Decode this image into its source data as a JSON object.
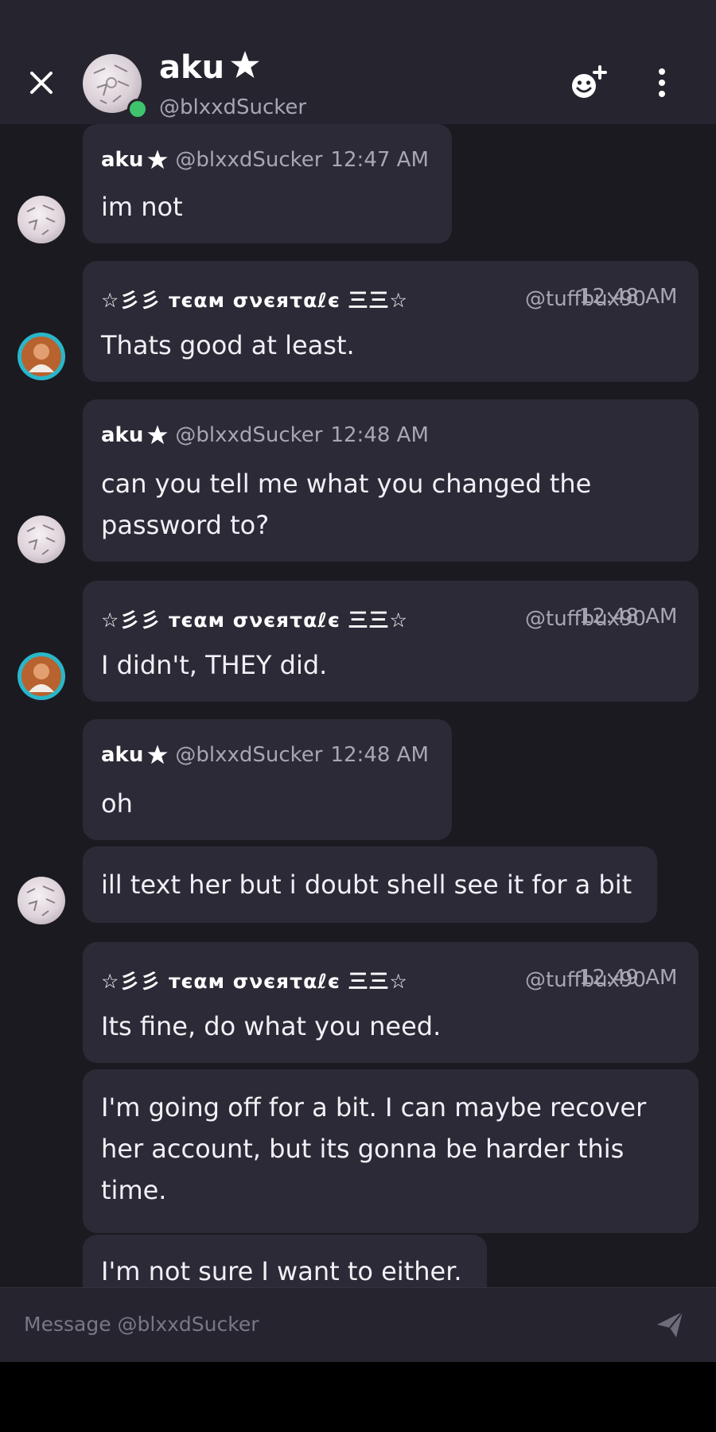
{
  "header": {
    "name": "aku",
    "handle": "@blxxdSucker",
    "status": "online"
  },
  "messages": [
    {
      "sender": "aku",
      "handle": "@blxxdSucker",
      "time": "12:47 AM",
      "text": "im not"
    },
    {
      "sender": "☆彡彡 тєαм σνєяταℓє 三三☆",
      "handle": "@tuffbux90",
      "time": "12:48 AM",
      "text": "Thats good at least."
    },
    {
      "sender": "aku",
      "handle": "@blxxdSucker",
      "time": "12:48 AM",
      "lines": [
        "can you tell me what you changed the",
        "password to?"
      ]
    },
    {
      "sender": "☆彡彡 тєαм σνєяταℓє 三三☆",
      "handle": "@tuffbux90",
      "time": "12:48 AM",
      "text": "I didn't, THEY did."
    },
    {
      "sender": "aku",
      "handle": "@blxxdSucker",
      "time": "12:48 AM",
      "text": "oh"
    },
    {
      "text": "ill text her but i doubt shell see it for a bit"
    },
    {
      "sender": "☆彡彡 тєαм σνєяταℓє 三三☆",
      "handle": "@tuffbux90",
      "time": "12:49 AM",
      "text": "Its fine, do what you need."
    },
    {
      "lines": [
        "I'm going off for a bit. I can maybe recover",
        "her account, but its gonna be harder this",
        "time."
      ]
    },
    {
      "text": "I'm not sure I want to either."
    }
  ],
  "composer": {
    "placeholder": "Message @blxxdSucker"
  },
  "icons": {
    "close": "close-icon",
    "add_friend": "add-friend-icon",
    "more": "more-vertical-icon",
    "send": "send-icon",
    "star": "star-icon"
  },
  "colors": {
    "background": "#1c1a21",
    "header": "#26242e",
    "bubble": "#2c2a36",
    "online": "#3ec46d",
    "tuff_avatar_ring": "#2ab6c9"
  }
}
